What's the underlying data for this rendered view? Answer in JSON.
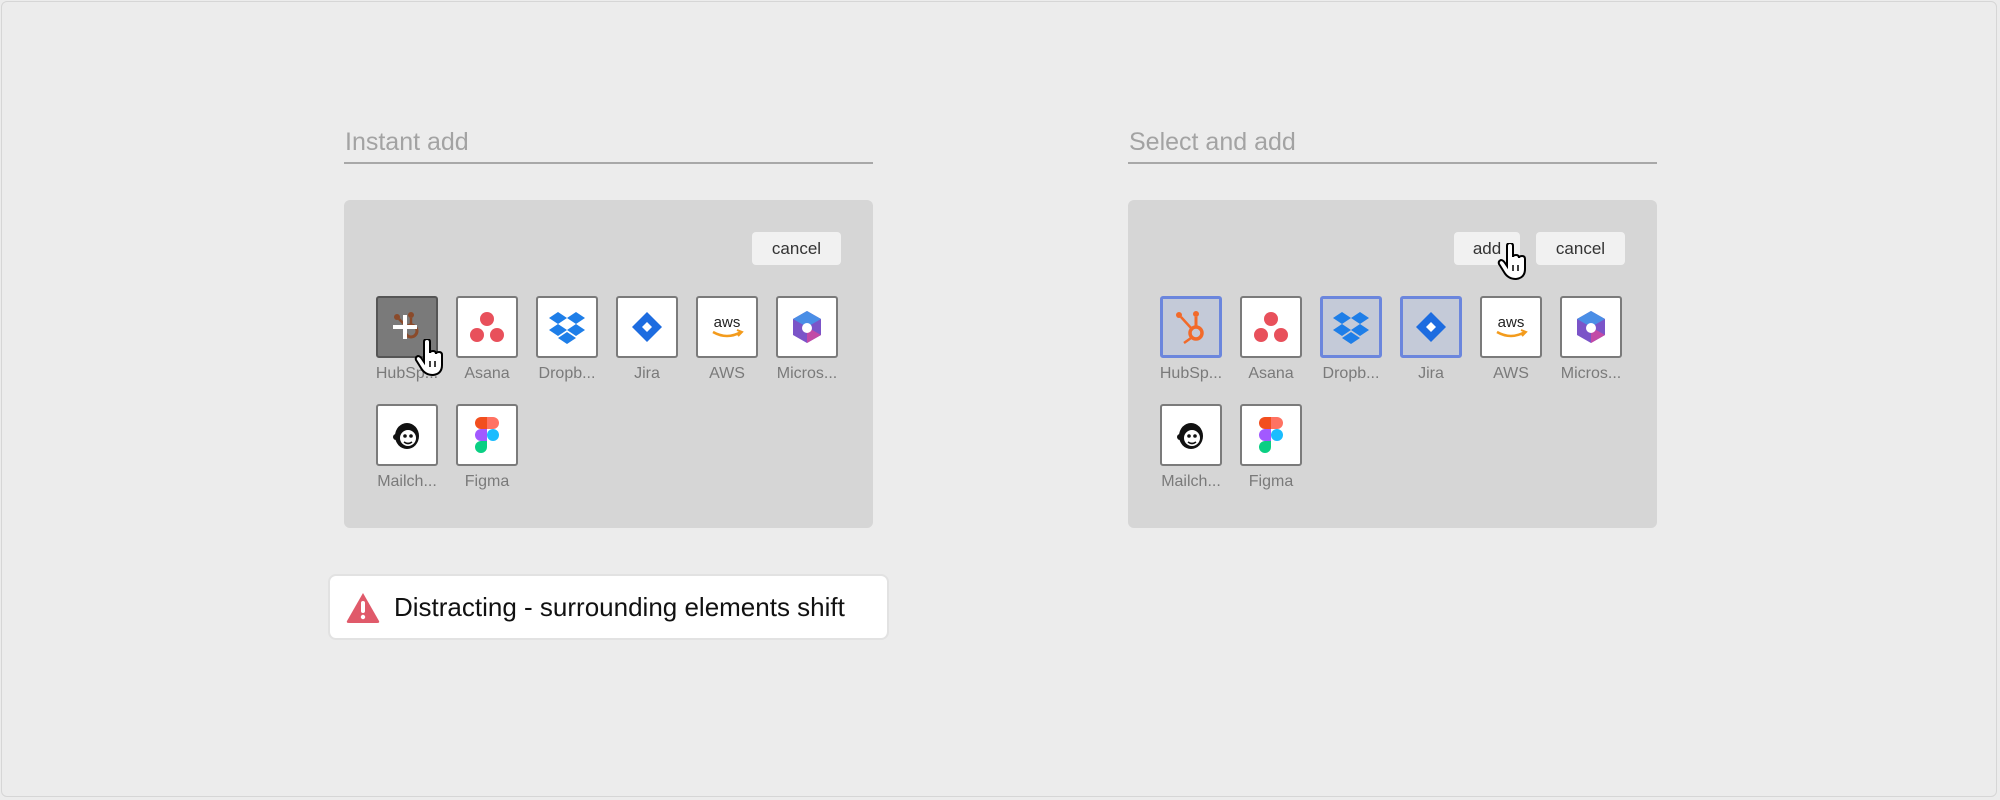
{
  "left": {
    "title": "Instant add",
    "cancel_label": "cancel",
    "tiles": [
      {
        "label": "HubSp...",
        "icon": "hubspot-icon",
        "state": "hover"
      },
      {
        "label": "Asana",
        "icon": "asana-icon",
        "state": "normal"
      },
      {
        "label": "Dropb...",
        "icon": "dropbox-icon",
        "state": "normal"
      },
      {
        "label": "Jira",
        "icon": "jira-icon",
        "state": "normal"
      },
      {
        "label": "AWS",
        "icon": "aws-icon",
        "state": "normal"
      },
      {
        "label": "Micros...",
        "icon": "microsoft-icon",
        "state": "normal"
      },
      {
        "label": "Mailch...",
        "icon": "mailchimp-icon",
        "state": "normal"
      },
      {
        "label": "Figma",
        "icon": "figma-icon",
        "state": "normal"
      }
    ]
  },
  "right": {
    "title": "Select and add",
    "add_label": "add",
    "cancel_label": "cancel",
    "tiles": [
      {
        "label": "HubSp...",
        "icon": "hubspot-icon",
        "state": "selected"
      },
      {
        "label": "Asana",
        "icon": "asana-icon",
        "state": "normal"
      },
      {
        "label": "Dropb...",
        "icon": "dropbox-icon",
        "state": "selected"
      },
      {
        "label": "Jira",
        "icon": "jira-icon",
        "state": "selected"
      },
      {
        "label": "AWS",
        "icon": "aws-icon",
        "state": "normal"
      },
      {
        "label": "Micros...",
        "icon": "microsoft-icon",
        "state": "normal"
      },
      {
        "label": "Mailch...",
        "icon": "mailchimp-icon",
        "state": "normal"
      },
      {
        "label": "Figma",
        "icon": "figma-icon",
        "state": "normal"
      }
    ]
  },
  "warning": {
    "text": "Distracting - surrounding elements shift",
    "icon": "warning-icon",
    "color": "#e05a6a"
  },
  "colors": {
    "selected_border": "#6b86dd",
    "panel_bg": "#d6d6d6",
    "page_bg": "#ececec"
  }
}
